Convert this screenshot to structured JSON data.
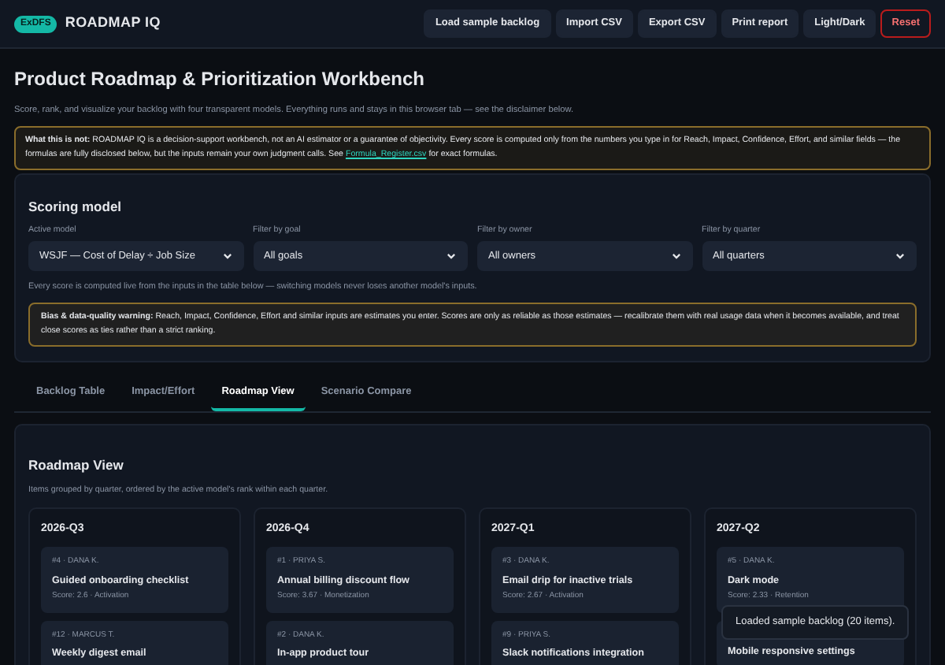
{
  "header": {
    "badge": "ExDFS",
    "title": "ROADMAP IQ",
    "buttons": [
      {
        "label": "Load sample backlog",
        "kind": "normal"
      },
      {
        "label": "Import CSV",
        "kind": "normal"
      },
      {
        "label": "Export CSV",
        "kind": "normal"
      },
      {
        "label": "Print report",
        "kind": "normal"
      },
      {
        "label": "Light/Dark",
        "kind": "normal"
      },
      {
        "label": "Reset",
        "kind": "danger"
      }
    ]
  },
  "page": {
    "title": "Product Roadmap & Prioritization Workbench",
    "subtitle": "Score, rank, and visualize your backlog with four transparent models. Everything runs and stays in this browser tab — see the disclaimer below."
  },
  "disclaimer": {
    "text": "**What this is not:** ROADMAP IQ is a decision-support workbench, not an AI estimator or a guarantee of objectivity. Every score is computed only from the numbers you type in for Reach, Impact, Confidence, Effort, and similar fields — the formulas are fully disclosed below, but the inputs remain your own judgment calls. See",
    "link": "Formula_Register.csv",
    "tail": "for exact formulas."
  },
  "scoring": {
    "title": "Scoring model",
    "filters": [
      {
        "label": "Active model",
        "value": "WSJF — Cost of Delay ÷ Job Size"
      },
      {
        "label": "Filter by goal",
        "value": "All goals"
      },
      {
        "label": "Filter by owner",
        "value": "All owners"
      },
      {
        "label": "Filter by quarter",
        "value": "All quarters"
      }
    ],
    "note": "Every score is computed live from the inputs in the table below — switching models never loses another model's inputs.",
    "warning": "**Bias & data-quality warning:** Reach, Impact, Confidence, Effort and similar inputs are estimates you enter. Scores are only as reliable as those estimates — recalibrate them with real usage data when it becomes available, and treat close scores as ties rather than a strict ranking."
  },
  "tabs": [
    {
      "label": "Backlog Table",
      "selected": false
    },
    {
      "label": "Impact/Effort",
      "selected": false
    },
    {
      "label": "Roadmap View",
      "selected": true
    },
    {
      "label": "Scenario Compare",
      "selected": false
    }
  ],
  "roadmap": {
    "title": "Roadmap View",
    "subtitle": "Items grouped by quarter, ordered by the active model's rank within each quarter.",
    "quarters": [
      {
        "name": "2026-Q3",
        "items": [
          {
            "meta": "#4 · DANA K.",
            "title": "Guided onboarding checklist",
            "score": "Score: 2.6 · Activation"
          },
          {
            "meta": "#12 · MARCUS T.",
            "title": "Weekly digest email"
          }
        ]
      },
      {
        "name": "2026-Q4",
        "items": [
          {
            "meta": "#1 · PRIYA S.",
            "title": "Annual billing discount flow",
            "score": "Score: 3.67 · Monetization"
          },
          {
            "meta": "#2 · DANA K.",
            "title": "In-app product tour"
          }
        ]
      },
      {
        "name": "2027-Q1",
        "items": [
          {
            "meta": "#3 · DANA K.",
            "title": "Email drip for inactive trials",
            "score": "Score: 2.67 · Activation"
          },
          {
            "meta": "#9 · PRIYA S.",
            "title": "Slack notifications integration"
          }
        ]
      },
      {
        "name": "2027-Q2",
        "items": [
          {
            "meta": "#5 · DANA K.",
            "title": "Dark mode",
            "score": "Score: 2.33 · Retention"
          },
          {
            "title": "Mobile responsive settings"
          }
        ]
      }
    ]
  },
  "toast": "Loaded sample backlog (20 items)."
}
